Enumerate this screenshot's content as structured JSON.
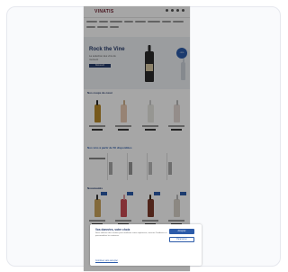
{
  "site": {
    "logo": "VINATIS",
    "hero": {
      "title": "Rock the Vine",
      "subtitle": "La sélection des vins du moment",
      "button": "Découvrir",
      "badge": "-20%"
    },
    "sections": [
      {
        "title": "Nos coups de cœur"
      },
      {
        "title": "Nos vins à partir de 5€ disponibles"
      },
      {
        "title": "Nouveautés"
      }
    ],
    "cookie_banner": {
      "title": "Vos données, votre choix",
      "text": "Nous utilisons des cookies pour améliorer votre expérience, mesurer l'audience et personnaliser les contenus.",
      "accept_label": "Accepter",
      "settings_label": "Paramétrer",
      "continue_label": "Continuer sans accepter"
    }
  },
  "colors": {
    "brand": "#263b6b",
    "accent": "#2c5ba9",
    "wine_red": "#6b1c2c"
  }
}
